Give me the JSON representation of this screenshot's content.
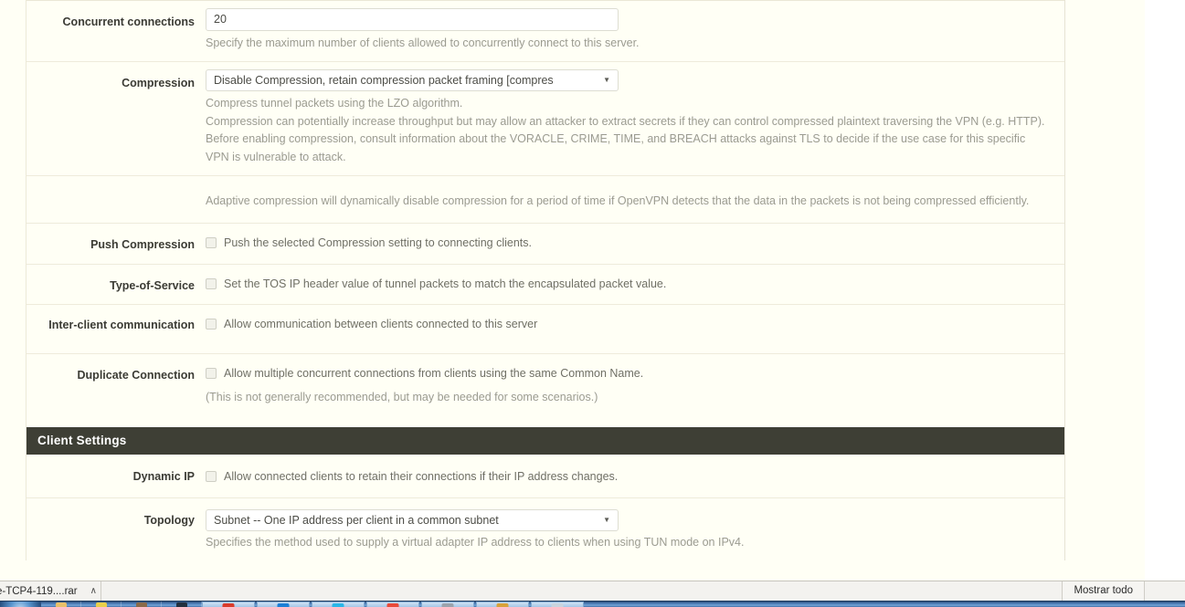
{
  "page": {
    "background_color": "#fffff5",
    "panel_border_color": "#eeebdb"
  },
  "form": {
    "rows": [
      {
        "id": "concurrent-connections",
        "label": "Concurrent connections",
        "control": "text",
        "value": "20",
        "help": "Specify the maximum number of clients allowed to concurrently connect to this server."
      },
      {
        "id": "compression",
        "label": "Compression",
        "control": "select",
        "value": "Disable Compression, retain compression packet framing [compres",
        "help_line_1": "Compress tunnel packets using the LZO algorithm.",
        "help_line_2": "Compression can potentially increase throughput but may allow an attacker to extract secrets if they can control compressed plaintext traversing the VPN (e.g. HTTP). Before enabling compression, consult information about the VORACLE, CRIME, TIME, and BREACH attacks against TLS to decide if the use case for this specific VPN is vulnerable to attack."
      },
      {
        "id": "adaptive-compression-note",
        "label": "",
        "control": "note",
        "help": "Adaptive compression will dynamically disable compression for a period of time if OpenVPN detects that the data in the packets is not being compressed efficiently."
      },
      {
        "id": "push-compression",
        "label": "Push Compression",
        "control": "checkbox",
        "checked": false,
        "checkbox_label": "Push the selected Compression setting to connecting clients."
      },
      {
        "id": "type-of-service",
        "label": "Type-of-Service",
        "control": "checkbox",
        "checked": false,
        "checkbox_label": "Set the TOS IP header value of tunnel packets to match the encapsulated packet value."
      },
      {
        "id": "inter-client-communication",
        "label": "Inter-client communication",
        "control": "checkbox",
        "checked": false,
        "checkbox_label": "Allow communication between clients connected to this server"
      },
      {
        "id": "duplicate-connection",
        "label": "Duplicate Connection",
        "control": "checkbox",
        "checked": false,
        "checkbox_label": "Allow multiple concurrent connections from clients using the same Common Name.",
        "subnote": "(This is not generally recommended, but may be needed for some scenarios.)"
      }
    ],
    "section_client_settings": {
      "title": "Client Settings",
      "rows": [
        {
          "id": "dynamic-ip",
          "label": "Dynamic IP",
          "control": "checkbox",
          "checked": false,
          "checkbox_label": "Allow connected clients to retain their connections if their IP address changes."
        },
        {
          "id": "topology",
          "label": "Topology",
          "control": "select",
          "value": "Subnet -- One IP address per client in a common subnet",
          "help": "Specifies the method used to supply a virtual adapter IP address to clients when using TUN mode on IPv4."
        }
      ]
    }
  },
  "download_bar": {
    "item_name": "e-TCP4-119....rar",
    "item_chevron": "∧",
    "show_all_label": "Mostrar todo"
  },
  "taskbar": {
    "start_label": "",
    "icon_colors": [
      "#e8c06a",
      "#e8cf4a",
      "#8a6a4a",
      "#23303f",
      "#d93b2b",
      "#1c7fd6",
      "#29b6e8",
      "#e84a3a",
      "#9aa3ad",
      "#d8a23a",
      "#c9d4de"
    ]
  }
}
